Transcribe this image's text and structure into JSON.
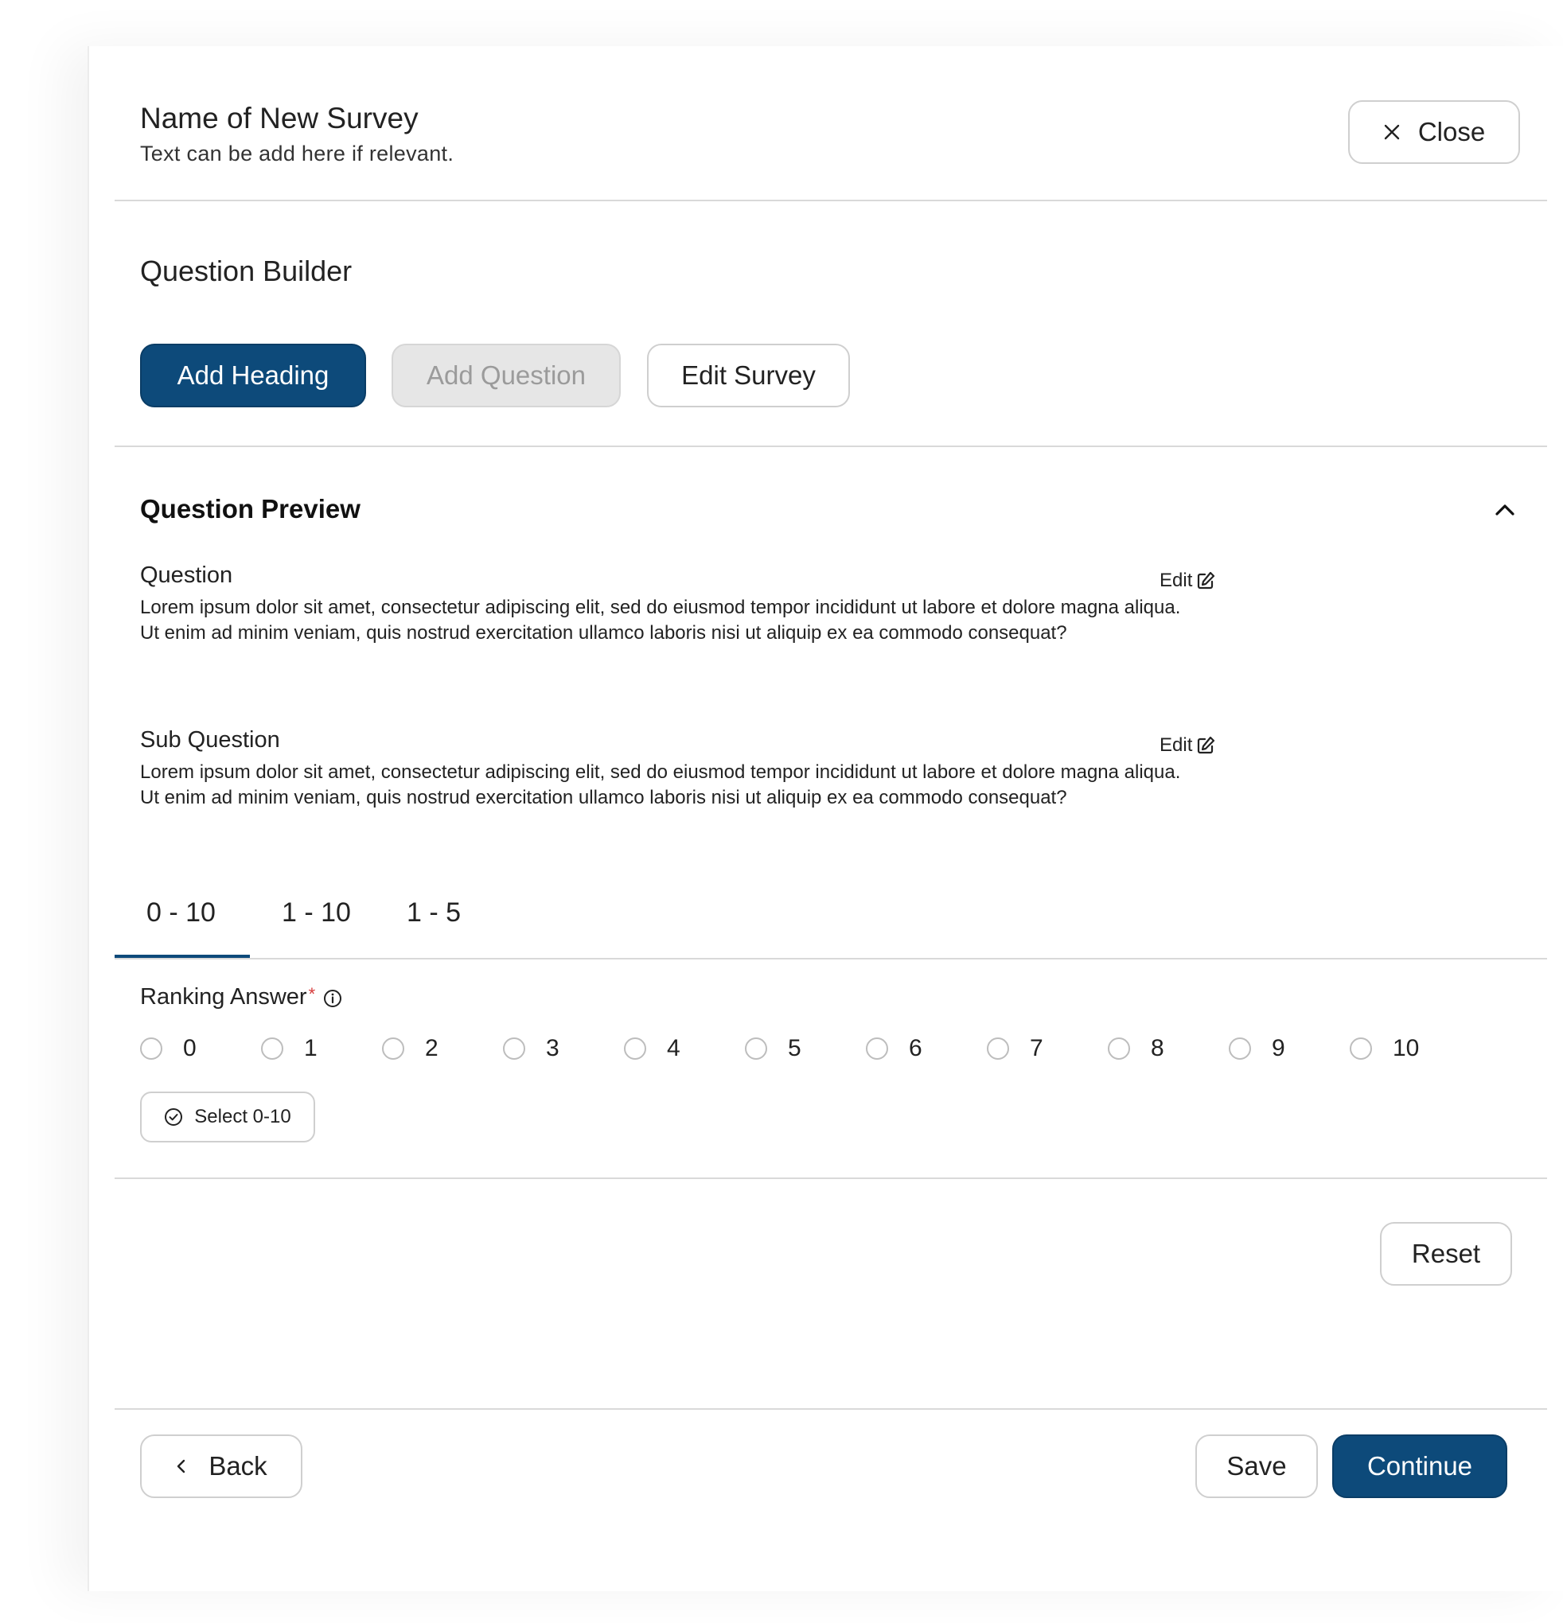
{
  "header": {
    "title": "Name of New Survey",
    "subtitle": "Text can be add here if relevant.",
    "close_label": "Close",
    "close_icon": "close-icon"
  },
  "builder": {
    "title": "Question Builder",
    "add_heading": "Add Heading",
    "add_question": "Add Question",
    "edit_survey": "Edit Survey"
  },
  "preview": {
    "title": "Question Preview",
    "question_label": "Question",
    "question_text": "Lorem ipsum dolor sit amet, consectetur adipiscing elit, sed do eiusmod tempor incididunt ut labore et dolore magna aliqua. Ut enim ad minim veniam, quis nostrud exercitation ullamco laboris nisi ut aliquip ex ea commodo consequat?",
    "subquestion_label": "Sub Question",
    "subquestion_text": "Lorem ipsum dolor sit amet, consectetur adipiscing elit, sed do eiusmod tempor incididunt ut labore et dolore magna aliqua. Ut enim ad minim veniam, quis nostrud exercitation ullamco laboris nisi ut aliquip ex ea commodo consequat?",
    "edit_label": "Edit"
  },
  "tabs": [
    "0 - 10",
    "1 - 10",
    "1 - 5"
  ],
  "active_tab": "0 - 10",
  "ranking": {
    "label": "Ranking Answer",
    "required_mark": "*",
    "options": [
      "0",
      "1",
      "2",
      "3",
      "4",
      "5",
      "6",
      "7",
      "8",
      "9",
      "10"
    ],
    "select_label": "Select 0-10"
  },
  "actions": {
    "reset": "Reset",
    "back": "Back",
    "save": "Save",
    "continue": "Continue"
  },
  "colors": {
    "primary": "#0d4a7a",
    "disabled_bg": "#e6e6e6",
    "required": "#d63b3b",
    "divider": "#d9d9d9"
  }
}
